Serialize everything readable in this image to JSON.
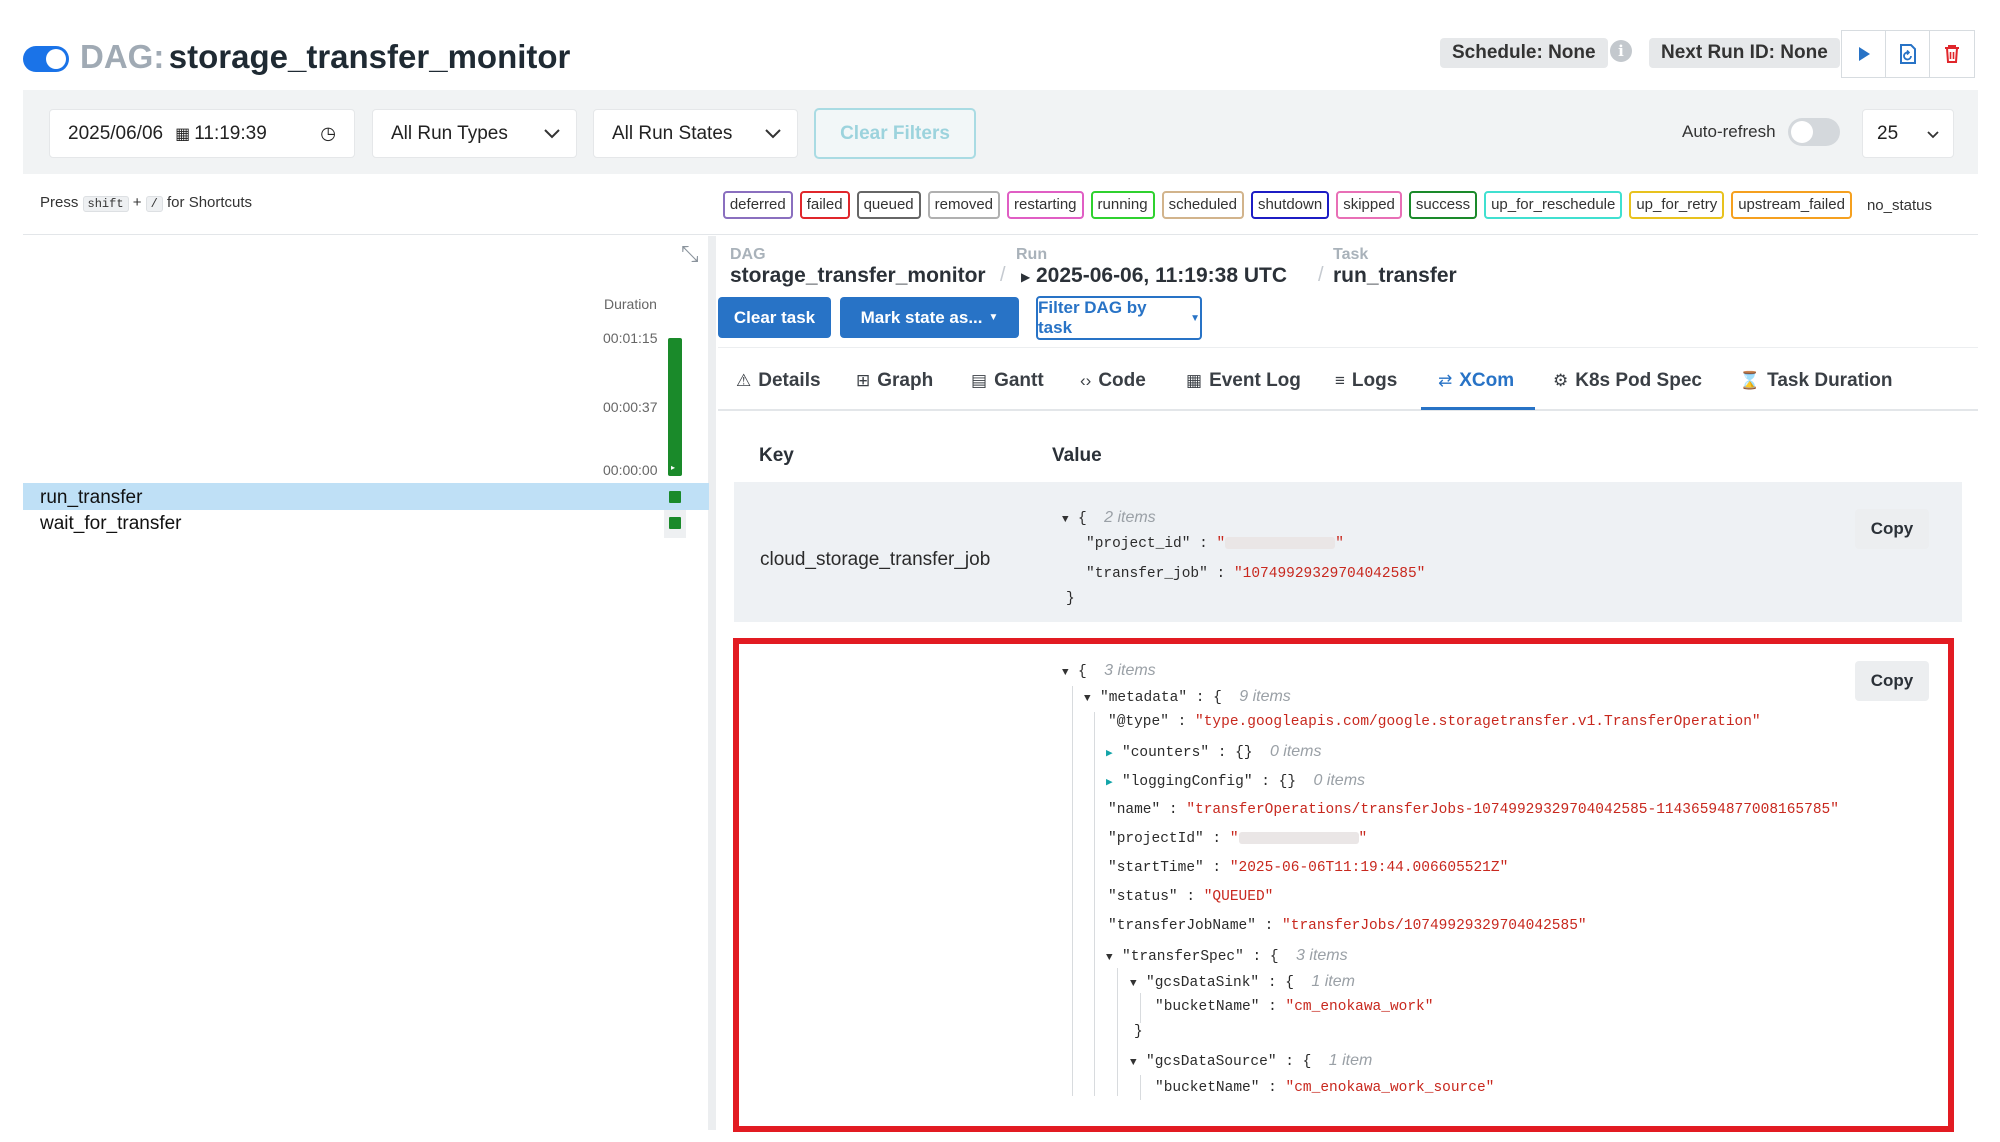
{
  "header": {
    "dag_prefix": "DAG:",
    "dag_name": "storage_transfer_monitor",
    "schedule": "Schedule: None",
    "next_run": "Next Run ID: None"
  },
  "filters": {
    "date": "2025/06/06",
    "time": "11:19:39",
    "run_types": "All Run Types",
    "run_states": "All Run States",
    "clear_filters": "Clear Filters",
    "auto_refresh": "Auto-refresh",
    "page_size": "25"
  },
  "shortcuts": {
    "press": "Press",
    "key1": "shift",
    "plus": "+",
    "key2": "/",
    "suffix": "for Shortcuts"
  },
  "states": [
    {
      "label": "deferred",
      "color": "#8a6fbf"
    },
    {
      "label": "failed",
      "color": "#e0262b"
    },
    {
      "label": "queued",
      "color": "#666666"
    },
    {
      "label": "removed",
      "color": "#b0b0b0"
    },
    {
      "label": "restarting",
      "color": "#e05ec4"
    },
    {
      "label": "running",
      "color": "#2fd12f"
    },
    {
      "label": "scheduled",
      "color": "#d2b48c"
    },
    {
      "label": "shutdown",
      "color": "#1c1cc4"
    },
    {
      "label": "skipped",
      "color": "#e86fb6"
    },
    {
      "label": "success",
      "color": "#1a8a2a"
    },
    {
      "label": "up_for_reschedule",
      "color": "#40e0d0"
    },
    {
      "label": "up_for_retry",
      "color": "#e8c21e"
    },
    {
      "label": "upstream_failed",
      "color": "#f5a01f"
    },
    {
      "label": "no_status",
      "color": ""
    }
  ],
  "grid": {
    "duration_label": "Duration",
    "ticks": [
      "00:01:15",
      "00:00:37",
      "00:00:00"
    ],
    "tasks": [
      "run_transfer",
      "wait_for_transfer"
    ]
  },
  "breadcrumb": {
    "dag_label": "DAG",
    "dag_value": "storage_transfer_monitor",
    "run_label": "Run",
    "run_value": "2025-06-06, 11:19:38 UTC",
    "task_label": "Task",
    "task_value": "run_transfer"
  },
  "actions": {
    "clear_task": "Clear task",
    "mark_state": "Mark state as...",
    "filter_dag": "Filter DAG by task"
  },
  "tabs": [
    {
      "icon": "⚠",
      "label": "Details"
    },
    {
      "icon": "⊞",
      "label": "Graph"
    },
    {
      "icon": "▤",
      "label": "Gantt"
    },
    {
      "icon": "‹›",
      "label": "Code"
    },
    {
      "icon": "▦",
      "label": "Event Log"
    },
    {
      "icon": "≡",
      "label": "Logs"
    },
    {
      "icon": "⇄",
      "label": "XCom"
    },
    {
      "icon": "⚙",
      "label": "K8s Pod Spec"
    },
    {
      "icon": "⌛",
      "label": "Task Duration"
    }
  ],
  "xcom": {
    "key_header": "Key",
    "value_header": "Value",
    "copy": "Copy",
    "row1_key": "cloud_storage_transfer_job",
    "row1": {
      "open": "{",
      "count": "2 items",
      "project_id_key": "\"project_id\"",
      "transfer_job_key": "\"transfer_job\"",
      "transfer_job_val": "\"10749929329704042585\"",
      "close": "}"
    },
    "row2": {
      "count": "3 items",
      "metadata_key": "\"metadata\"",
      "metadata_count": "9 items",
      "type_key": "\"@type\"",
      "type_val": "\"type.googleapis.com/google.storagetransfer.v1.TransferOperation\"",
      "counters_key": "\"counters\"",
      "counters_count": "0 items",
      "logging_key": "\"loggingConfig\"",
      "logging_count": "0 items",
      "name_key": "\"name\"",
      "name_val": "\"transferOperations/transferJobs-10749929329704042585-11436594877008165785\"",
      "projectid_key": "\"projectId\"",
      "start_key": "\"startTime\"",
      "start_val": "\"2025-06-06T11:19:44.006605521Z\"",
      "status_key": "\"status\"",
      "status_val": "\"QUEUED\"",
      "tjn_key": "\"transferJobName\"",
      "tjn_val": "\"transferJobs/10749929329704042585\"",
      "spec_key": "\"transferSpec\"",
      "spec_count": "3 items",
      "sink_key": "\"gcsDataSink\"",
      "sink_count": "1 item",
      "bucket_key": "\"bucketName\"",
      "sink_bucket": "\"cm_enokawa_work\"",
      "source_key": "\"gcsDataSource\"",
      "source_count": "1 item",
      "source_bucket": "\"cm_enokawa_work_source\""
    }
  }
}
